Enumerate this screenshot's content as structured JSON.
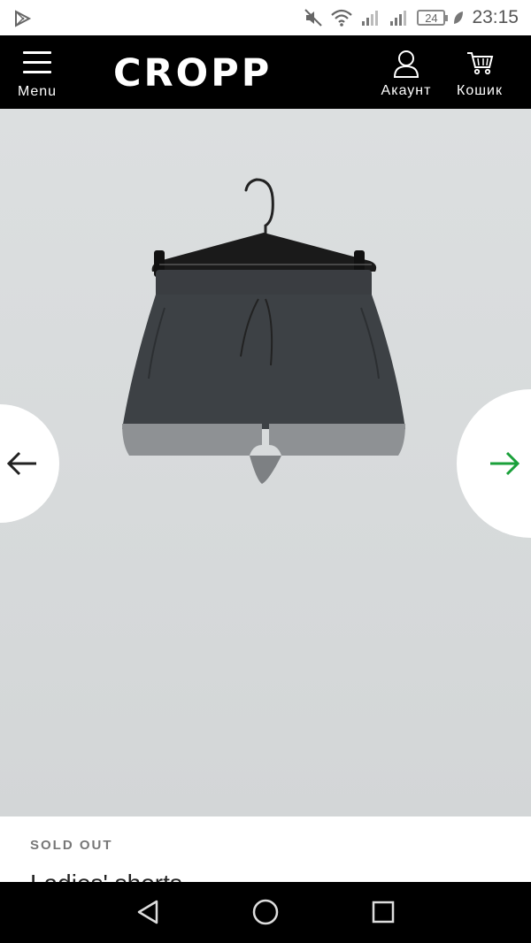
{
  "status_bar": {
    "time": "23:15",
    "battery": "24"
  },
  "header": {
    "menu_label": "Menu",
    "logo": "CROPP",
    "account_label": "Акаунт",
    "cart_label": "Кошик"
  },
  "product": {
    "stock_status": "SOLD OUT",
    "name": "Ladies' shorts"
  },
  "colors": {
    "header_bg": "#000000",
    "next_arrow": "#1aa03a",
    "prev_arrow": "#222222"
  }
}
